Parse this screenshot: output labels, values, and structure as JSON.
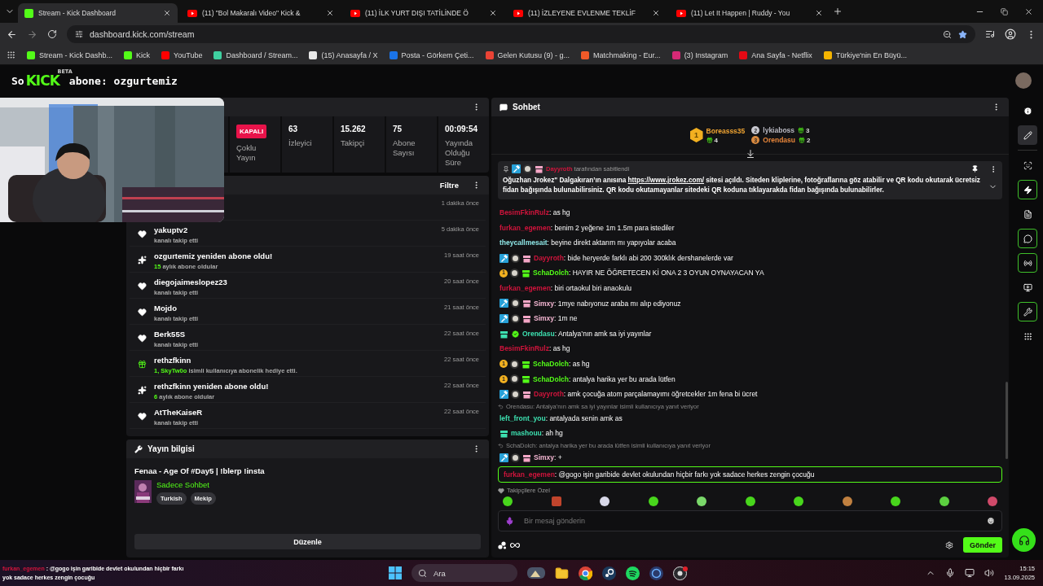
{
  "browser": {
    "tabs": [
      {
        "title": "Stream - Kick Dashboard",
        "kind": "kick",
        "selected": true
      },
      {
        "title": "(11) \"Bol Makaralı Video\" Kick &",
        "kind": "youtube",
        "selected": false
      },
      {
        "title": "(11) İLK YURT DIŞI TATİLİNDE Ö",
        "kind": "youtube",
        "selected": false
      },
      {
        "title": "(11) İZLEYENE EVLENME TEKLİF",
        "kind": "youtube",
        "selected": false
      },
      {
        "title": "(11) Let It Happen | Ruddy - You",
        "kind": "youtube",
        "selected": false
      }
    ],
    "address": "dashboard.kick.com/stream",
    "bookmarks": [
      {
        "label": "Stream - Kick Dashb...",
        "color": "#53fc18"
      },
      {
        "label": "Kick",
        "color": "#53fc18"
      },
      {
        "label": "YouTube",
        "color": "#ff0000"
      },
      {
        "label": "Dashboard / Stream...",
        "color": "#3fd0a0"
      },
      {
        "label": "(15) Anasayfa / X",
        "color": "#e8e8e8"
      },
      {
        "label": "Posta - Görkem Çeti...",
        "color": "#1a73e8"
      },
      {
        "label": "Gelen Kutusu (9) - g...",
        "color": "#ea4335"
      },
      {
        "label": "Matchmaking - Eur...",
        "color": "#f05a28"
      },
      {
        "label": "(3) Instagram",
        "color": "#d62976"
      },
      {
        "label": "Ana Sayfa - Netflix",
        "color": "#e50914"
      },
      {
        "label": "Türkiye'nin En Büyü...",
        "color": "#f4b400"
      }
    ]
  },
  "header": {
    "prefix": "So",
    "logo": "KICK",
    "logo_tag": "BETA",
    "suffix": "abone: ozgurtemiz"
  },
  "stats": {
    "status": "KAPALI",
    "status_label": "Çoklu Yayın",
    "items": [
      {
        "value": "63",
        "label": "İzleyici"
      },
      {
        "value": "15.262",
        "label": "Takipçi"
      },
      {
        "value": "75",
        "label": "Abone Sayısı"
      },
      {
        "value": "00:09:54",
        "label": "Yayında Olduğu Süre"
      }
    ]
  },
  "activity": {
    "filter": "Filtre",
    "items": [
      {
        "kind": "hidden",
        "time": "1 dakika önce"
      },
      {
        "kind": "follow",
        "name": "yakuptv2",
        "subtitle": "kanalı takip etti",
        "time": "5 dakika önce"
      },
      {
        "kind": "resub",
        "name": "ozgurtemiz yeniden abone oldu!",
        "highlight": "15",
        "subtitle": "aylık abone oldular",
        "time": "19 saat önce"
      },
      {
        "kind": "follow",
        "name": "diegojaimeslopez23",
        "subtitle": "kanalı takip etti",
        "time": "20 saat önce"
      },
      {
        "kind": "follow",
        "name": "Mojdo",
        "subtitle": "kanalı takip etti",
        "time": "21 saat önce"
      },
      {
        "kind": "follow",
        "name": "Berk55S",
        "subtitle": "kanalı takip etti",
        "time": "22 saat önce"
      },
      {
        "kind": "gift",
        "name": "rethzfkinn",
        "highlight": "1, SkyTw0o",
        "subtitle": "isimli kullanıcıya abonelik hediye etti.",
        "time": "22 saat önce"
      },
      {
        "kind": "resub",
        "name": "rethzfkinn yeniden abone oldu!",
        "highlight": "6",
        "subtitle": "aylık abone oldular",
        "time": "22 saat önce"
      },
      {
        "kind": "follow",
        "name": "AtTheKaiseR",
        "subtitle": "kanalı takip etti",
        "time": "22 saat önce"
      }
    ]
  },
  "stream_info": {
    "title": "Yayın bilgisi",
    "stream_title": "Fenaa - Age Of #Day5 | !blerp !insta",
    "category": "Sadece Sohbet",
    "tags": [
      "Turkish",
      "Mekip"
    ],
    "edit": "Düzenle"
  },
  "chat": {
    "title": "Sohbet",
    "leaderboard": [
      {
        "rank": "1",
        "name": "Boreasss35",
        "count": "4",
        "color": "#f2a532"
      },
      {
        "rank": "2",
        "name": "lykiaboss",
        "count": "3",
        "color": "#b9b9c2"
      },
      {
        "rank": "3",
        "name": "Orendasu",
        "count": "2",
        "color": "#e8863a"
      }
    ],
    "pinned": {
      "badges": [
        {
          "kind": "moderator"
        },
        {
          "kind": "avatar"
        },
        {
          "kind": "subscriber",
          "color": "#f4a6c6"
        }
      ],
      "user": "Dayyroth",
      "color": "#d0143c",
      "by": "tarafından sabitlendi",
      "before": "Oğuzhan Jrokez\" Dalgakıran’ın anısına",
      "link": "https://www.jrokez.com/",
      "after": "sitesi açıldı. Siteden kliplerine, fotoğraflarına göz atabilir ve QR kodu okutarak ücretsiz fidan bağışında bulunabilirsiniz. QR kodu okutamayanlar sitedeki QR koduna tıklayarakda fidan bağışında bulunabilirler."
    },
    "messages": [
      {
        "user": "BesimFkinRulz",
        "color": "#d0143c",
        "text": ": as hg"
      },
      {
        "user": "furkan_egemen",
        "color": "#d0143c",
        "text": ": benim 2 yeğene 1m 1.5m para istediler"
      },
      {
        "user": "theycallmesait",
        "color": "#8ee6e6",
        "text": ": beyine direkt aktarım mı yapıyolar acaba"
      },
      {
        "badges": [
          {
            "kind": "moderator"
          },
          {
            "kind": "avatar"
          },
          {
            "kind": "subscriber",
            "color": "#f4a6c6"
          }
        ],
        "user": "Dayyroth",
        "color": "#d0143c",
        "text": ": bide heryerde farklı abi 200 300klık dershanelerde var"
      },
      {
        "badges": [
          {
            "kind": "rank",
            "label": "1"
          },
          {
            "kind": "avatar"
          },
          {
            "kind": "subscriber",
            "color": "#53fc18"
          }
        ],
        "user": "SchaDolch",
        "color": "#53fc18",
        "text": ": HAYIR NE ÖĞRETECEN Kİ ONA 2 3 OYUN OYNAYACAN YA"
      },
      {
        "user": "furkan_egemen",
        "color": "#d0143c",
        "text": ": biri ortaokul biri anaokulu"
      },
      {
        "badges": [
          {
            "kind": "moderator"
          },
          {
            "kind": "avatar"
          },
          {
            "kind": "subscriber",
            "color": "#f4a6c6"
          }
        ],
        "user": "Simxy",
        "color": "#f4b6d2",
        "text": ": 1mye nabıyonuz araba mı alıp ediyonuz"
      },
      {
        "badges": [
          {
            "kind": "moderator"
          },
          {
            "kind": "avatar"
          },
          {
            "kind": "subscriber",
            "color": "#f4a6c6"
          }
        ],
        "user": "Simxy",
        "color": "#f4b6d2",
        "text": ": 1m ne"
      },
      {
        "badges": [
          {
            "kind": "subscriber",
            "color": "#3de0b0"
          },
          {
            "kind": "verified"
          }
        ],
        "user": "Orendasu",
        "color": "#3de0b0",
        "text": ": Antalya’nın amk sa iyi yayınlar"
      },
      {
        "user": "BesimFkinRulz",
        "color": "#d0143c",
        "text": ": as hg"
      },
      {
        "badges": [
          {
            "kind": "rank",
            "label": "1"
          },
          {
            "kind": "avatar"
          },
          {
            "kind": "subscriber",
            "color": "#53fc18"
          }
        ],
        "user": "SchaDolch",
        "color": "#53fc18",
        "text": ": as hg"
      },
      {
        "badges": [
          {
            "kind": "rank",
            "label": "1"
          },
          {
            "kind": "avatar"
          },
          {
            "kind": "subscriber",
            "color": "#53fc18"
          }
        ],
        "user": "SchaDolch",
        "color": "#53fc18",
        "text": ": antalya harika yer bu arada lütfen"
      },
      {
        "badges": [
          {
            "kind": "moderator"
          },
          {
            "kind": "avatar"
          },
          {
            "kind": "subscriber",
            "color": "#f4a6c6"
          }
        ],
        "user": "Dayyroth",
        "color": "#d0143c",
        "text": ": amk çocuğa atom parçalamayımı öğretcekler 1m fena bi ücret"
      },
      {
        "reply": "Orendasu: Antalya’nın amk sa iyi yayınlar isimli kullanıcıya yanıt veriyor",
        "user": "left_front_you",
        "color": "#3de0b0",
        "text": ": antalyada senin amk as"
      },
      {
        "badges": [
          {
            "kind": "subscriber",
            "color": "#3de0b0"
          }
        ],
        "user": "mashouu",
        "color": "#3de0b0",
        "text": ": ah hg"
      },
      {
        "reply": "SchaDolch: antalya harika yer bu arada lütfen isimli kullanıcıya yanıt veriyor",
        "badges": [
          {
            "kind": "moderator"
          },
          {
            "kind": "avatar"
          },
          {
            "kind": "subscriber",
            "color": "#f4a6c6"
          }
        ],
        "user": "Simxy",
        "color": "#f4b6d2",
        "text": ": +"
      }
    ],
    "highlight": {
      "user": "furkan_egemen",
      "color": "#d0143c",
      "text": ": @gogo işin garibide devlet okulundan hiçbir farkı yok sadace herkes zengin çocuğu"
    },
    "emote_label": "Takipçilere Özel",
    "placeholder": "Bir mesaj gönderin",
    "send": "Gönder"
  },
  "sidebar": [
    {
      "kind": "info",
      "selected": false,
      "enabled": false
    },
    {
      "kind": "edit",
      "selected": true,
      "enabled": false
    },
    {
      "kind": "scan",
      "selected": false,
      "enabled": false
    },
    {
      "kind": "zap",
      "selected": false,
      "enabled": true
    },
    {
      "kind": "notes",
      "selected": false,
      "enabled": false
    },
    {
      "kind": "chat",
      "selected": false,
      "enabled": true
    },
    {
      "kind": "broadcast",
      "selected": false,
      "enabled": true
    },
    {
      "kind": "scenes",
      "selected": false,
      "enabled": false
    },
    {
      "kind": "tools",
      "selected": false,
      "enabled": true
    },
    {
      "kind": "apps",
      "selected": false,
      "enabled": false
    }
  ],
  "taskbar": {
    "overlay_user": "furkan_egemen",
    "overlay_text": ": @gogo işin garibide devlet okulundan hiçbir farkı yok sadace herkes zengin çocuğu",
    "search": "Ara",
    "time": "15:15",
    "date": "13.09.2025"
  }
}
